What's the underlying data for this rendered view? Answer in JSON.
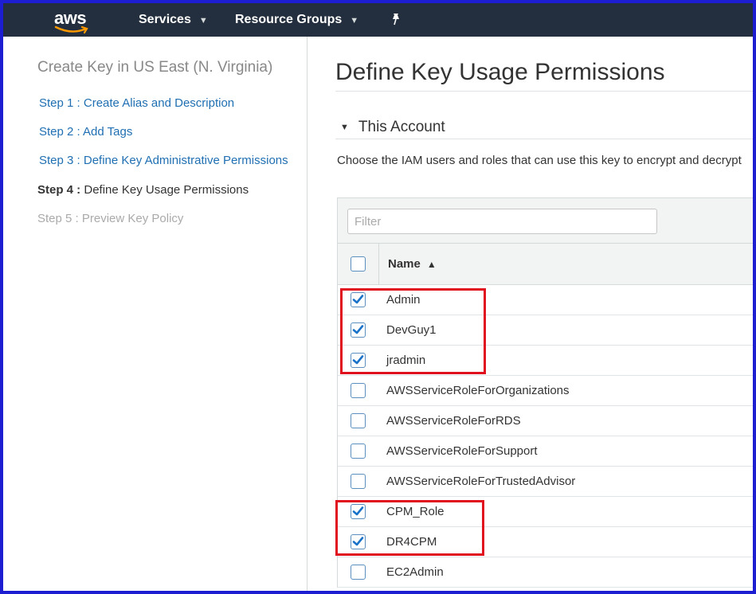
{
  "topnav": {
    "logo": "aws",
    "services_label": "Services",
    "resource_groups_label": "Resource Groups",
    "pin_icon": "pin-icon"
  },
  "sidebar": {
    "title": "Create Key in US East (N. Virginia)",
    "steps": [
      {
        "prefix": "Step 1 :",
        "label": "Create Alias and Description",
        "state": "link"
      },
      {
        "prefix": "Step 2 :",
        "label": "Add Tags",
        "state": "link"
      },
      {
        "prefix": "Step 3 :",
        "label": "Define Key Administrative Permissions",
        "state": "link"
      },
      {
        "prefix": "Step 4 :",
        "label": "Define Key Usage Permissions",
        "state": "current"
      },
      {
        "prefix": "Step 5 :",
        "label": "Preview Key Policy",
        "state": "future"
      }
    ]
  },
  "main": {
    "title": "Define Key Usage Permissions",
    "section_title": "This Account",
    "description": "Choose the IAM users and roles that can use this key to encrypt and decrypt",
    "filter_placeholder": "Filter",
    "column_name": "Name",
    "rows": [
      {
        "name": "Admin",
        "checked": true
      },
      {
        "name": "DevGuy1",
        "checked": true
      },
      {
        "name": "jradmin",
        "checked": true
      },
      {
        "name": "AWSServiceRoleForOrganizations",
        "checked": false
      },
      {
        "name": "AWSServiceRoleForRDS",
        "checked": false
      },
      {
        "name": "AWSServiceRoleForSupport",
        "checked": false
      },
      {
        "name": "AWSServiceRoleForTrustedAdvisor",
        "checked": false
      },
      {
        "name": "CPM_Role",
        "checked": true
      },
      {
        "name": "DR4CPM",
        "checked": true
      },
      {
        "name": "EC2Admin",
        "checked": false
      }
    ]
  },
  "colors": {
    "nav_bg": "#232f3e",
    "link": "#1f6fb2",
    "checkbox": "#1a73c9",
    "highlight": "#e0101f",
    "frame": "#1d1dd1"
  }
}
